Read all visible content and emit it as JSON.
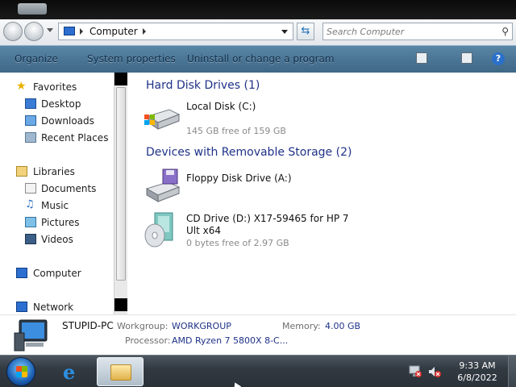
{
  "address": {
    "crumb": "Computer"
  },
  "search": {
    "placeholder": "Search Computer"
  },
  "toolbar": {
    "organize": "Organize",
    "system_properties": "System properties",
    "uninstall": "Uninstall or change a program"
  },
  "navpane": {
    "favorites": "Favorites",
    "desktop": "Desktop",
    "downloads": "Downloads",
    "recent": "Recent Places",
    "libraries": "Libraries",
    "documents": "Documents",
    "music": "Music",
    "pictures": "Pictures",
    "videos": "Videos",
    "computer": "Computer",
    "network": "Network"
  },
  "content": {
    "hdd_group": "Hard Disk Drives (1)",
    "removable_group": "Devices with Removable Storage (2)",
    "drives": [
      {
        "name": "Local Disk (C:)",
        "free": "145 GB free of 159 GB"
      },
      {
        "name": "Floppy Disk Drive (A:)"
      },
      {
        "name_line1": "CD Drive (D:) X17-59465 for HP 7",
        "name_line2": "Ult x64",
        "free": "0 bytes free of 2.97 GB"
      }
    ]
  },
  "details": {
    "pc_name": "STUPID-PC",
    "workgroup_label": "Workgroup:",
    "workgroup_value": "WORKGROUP",
    "memory_label": "Memory:",
    "memory_value": "4.00 GB",
    "processor_label": "Processor:",
    "processor_value": "AMD Ryzen 7 5800X 8-C..."
  },
  "taskbar": {
    "time": "9:33 AM",
    "date": "6/8/2022"
  },
  "colors": {
    "command_bar": "#4d7797",
    "group_heading": "#1e3287",
    "taskbar": "#323a42"
  }
}
